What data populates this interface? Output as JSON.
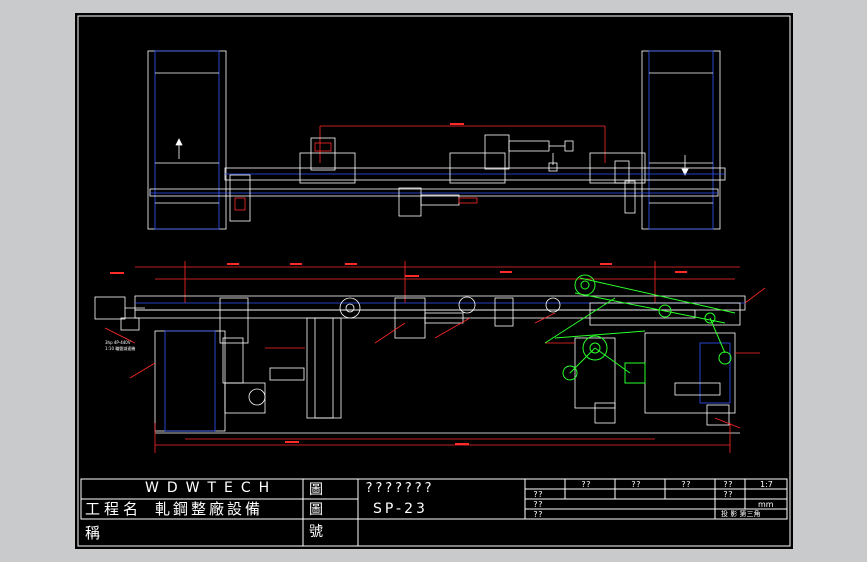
{
  "title_block": {
    "company": "WDWTECH",
    "project_label": "工程名",
    "project_label_2": "稱",
    "project_name": "軋鋼整廠設備",
    "drawing_title_label": "圖",
    "drawing_no_label": "圖",
    "drawing_no_label_2": "號",
    "drawing_title": "???????",
    "drawing_no": "SP-23",
    "cell_q1": "??",
    "cell_q2": "??",
    "cell_q3": "??",
    "cell_q4": "??",
    "cell_q5": "??",
    "cell_q6": "??",
    "cell_q7": "??",
    "cell_q8": "??",
    "scale": "1:7",
    "unit": "mm",
    "projection": "投 影 第三角"
  },
  "annotations": {
    "spec_line_1": "3hp 4P-440V",
    "spec_line_2": "1:10 輪盤減速機"
  },
  "colors": {
    "sheet": "#000000",
    "outline": "#ffffff",
    "dimension": "#ff2a2a",
    "moving_part": "#2aff2a",
    "hidden": "#3355ff",
    "frame": "#c9cacb"
  }
}
